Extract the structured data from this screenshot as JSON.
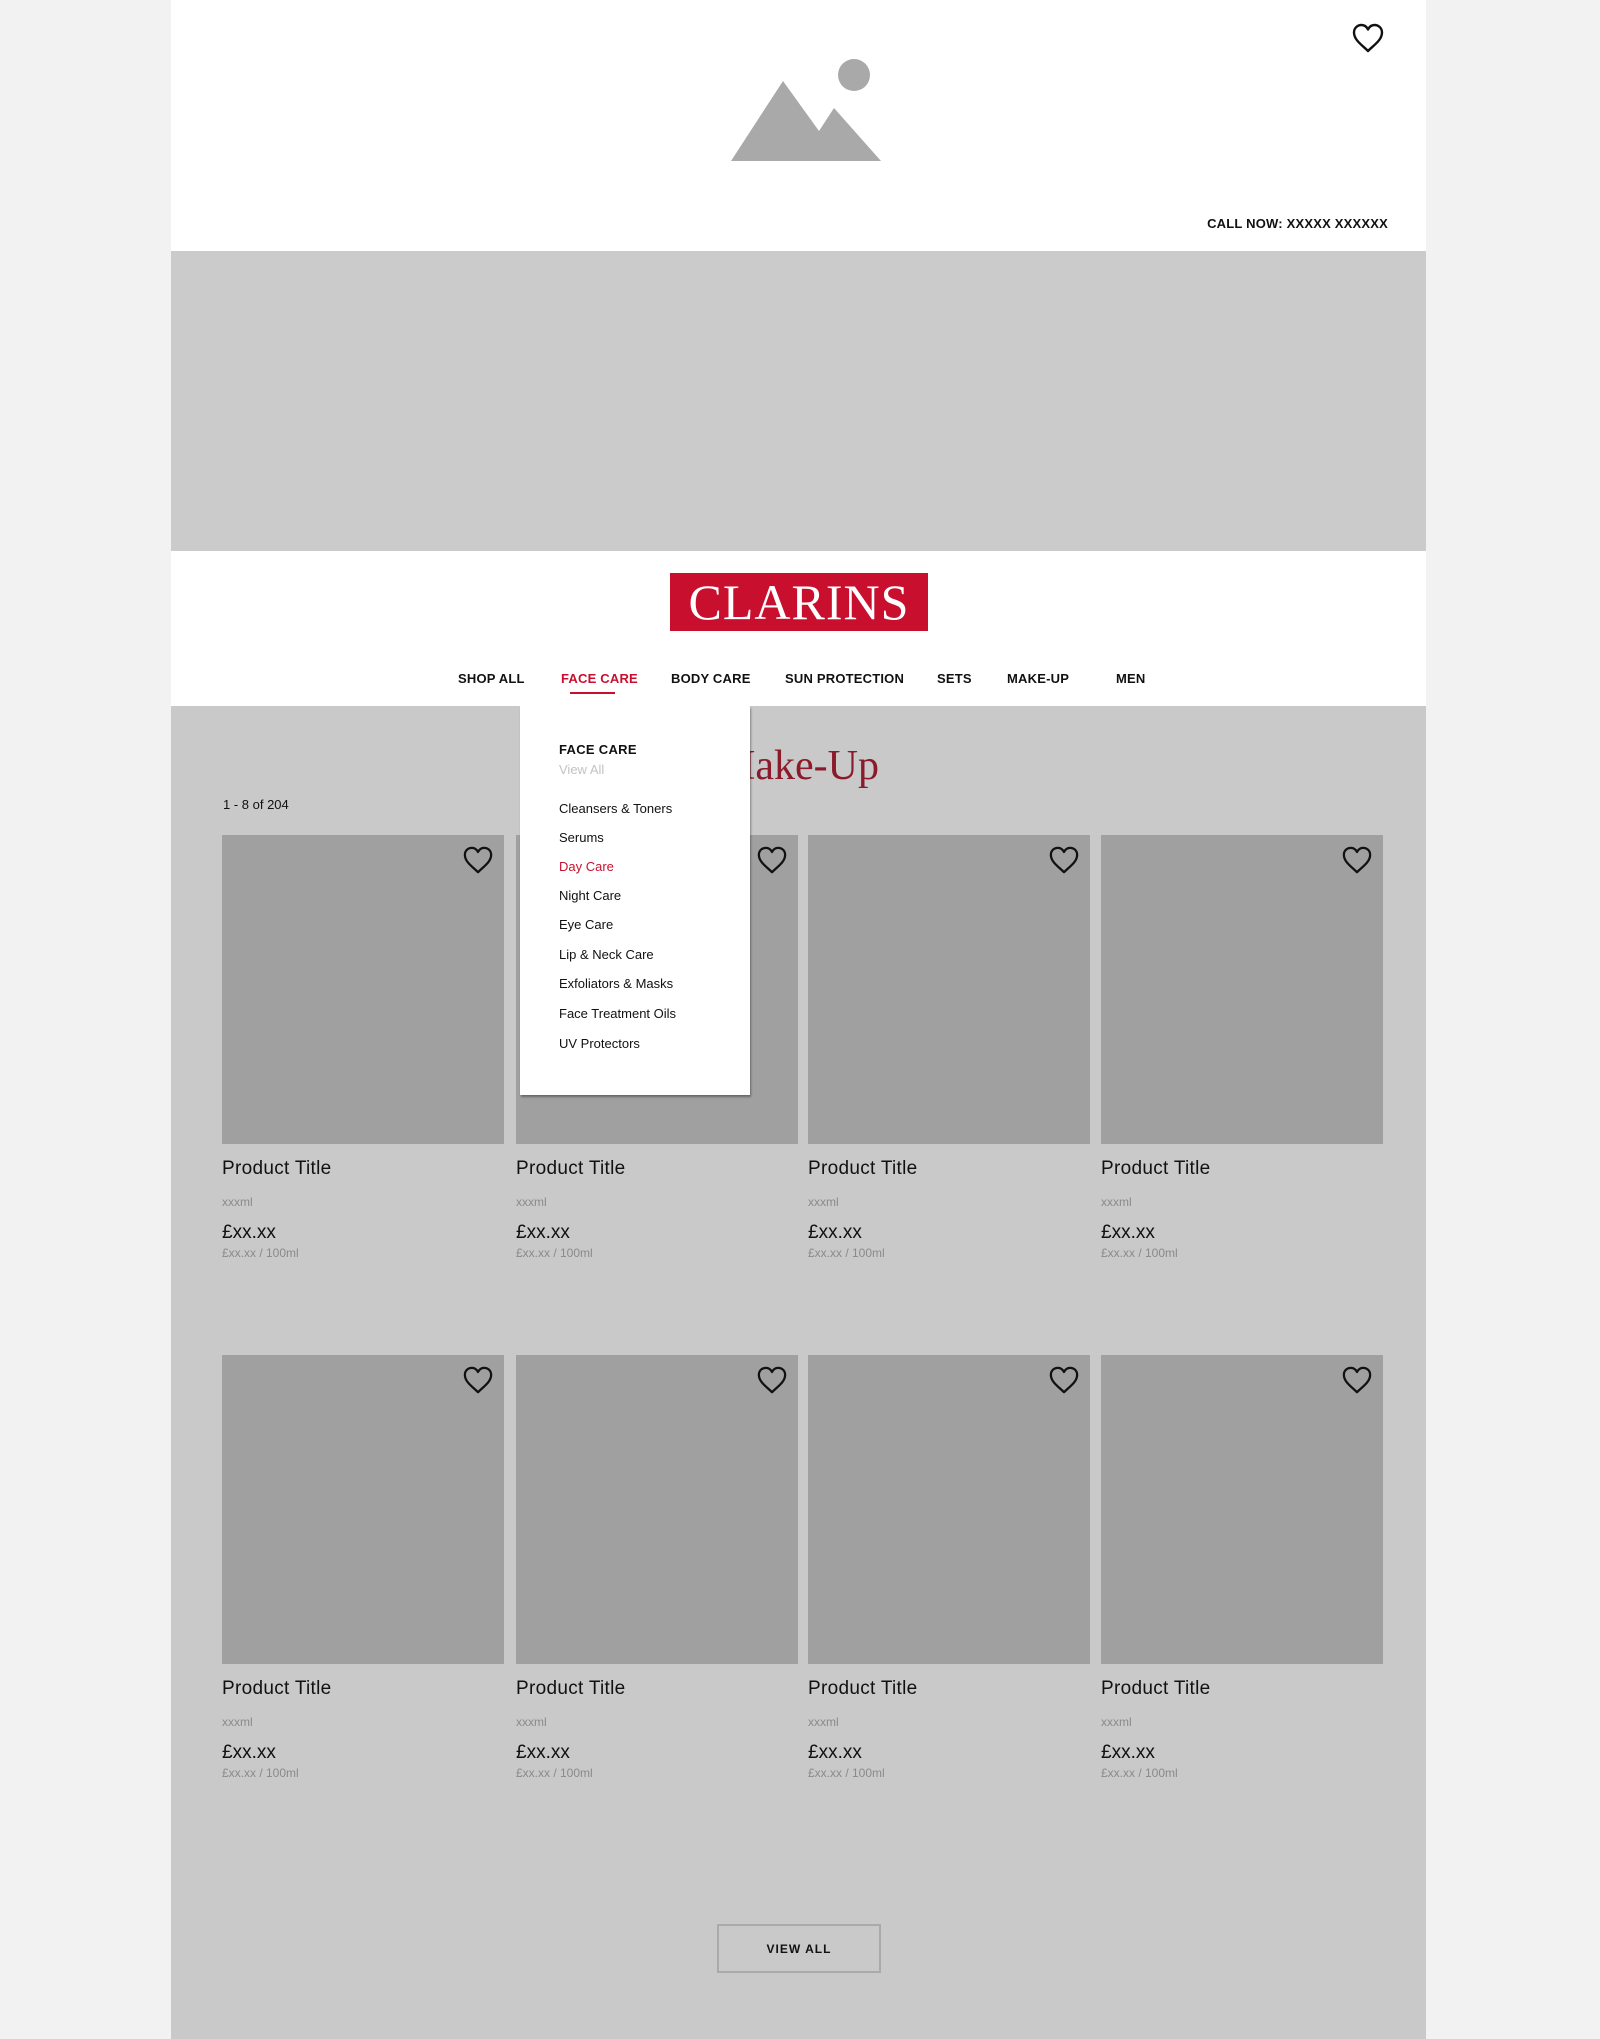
{
  "header": {
    "call_now": "CALL NOW: XXXXX XXXXXX",
    "wishlist_icon": "heart-outline-icon",
    "image_icon": "image-placeholder-icon"
  },
  "brand": {
    "logo_text": "CLARINS",
    "logo_color": "#c8102e"
  },
  "nav": {
    "items": [
      {
        "label": "SHOP ALL"
      },
      {
        "label": "FACE CARE",
        "active": true
      },
      {
        "label": "BODY CARE"
      },
      {
        "label": "SUN PROTECTION"
      },
      {
        "label": "SETS"
      },
      {
        "label": "MAKE-UP"
      },
      {
        "label": "MEN"
      }
    ]
  },
  "dropdown": {
    "title": "FACE CARE",
    "view_all": "View All",
    "items": [
      {
        "label": "Cleansers & Toners"
      },
      {
        "label": "Serums"
      },
      {
        "label": "Day Care",
        "active": true
      },
      {
        "label": "Night Care"
      },
      {
        "label": "Eye Care"
      },
      {
        "label": "Lip & Neck Care"
      },
      {
        "label": "Exfoliators & Masks"
      },
      {
        "label": "Face Treatment Oils"
      },
      {
        "label": "UV Protectors"
      }
    ]
  },
  "listing": {
    "heading": "Make-Up",
    "count": "1 - 8 of 204",
    "products": [
      {
        "title": "Product Title",
        "size": "xxxml",
        "price": "£xx.xx",
        "unit_price": "£xx.xx / 100ml"
      },
      {
        "title": "Product Title",
        "size": "xxxml",
        "price": "£xx.xx",
        "unit_price": "£xx.xx / 100ml"
      },
      {
        "title": "Product Title",
        "size": "xxxml",
        "price": "£xx.xx",
        "unit_price": "£xx.xx / 100ml"
      },
      {
        "title": "Product Title",
        "size": "xxxml",
        "price": "£xx.xx",
        "unit_price": "£xx.xx / 100ml"
      },
      {
        "title": "Product Title",
        "size": "xxxml",
        "price": "£xx.xx",
        "unit_price": "£xx.xx / 100ml"
      },
      {
        "title": "Product Title",
        "size": "xxxml",
        "price": "£xx.xx",
        "unit_price": "£xx.xx / 100ml"
      },
      {
        "title": "Product Title",
        "size": "xxxml",
        "price": "£xx.xx",
        "unit_price": "£xx.xx / 100ml"
      },
      {
        "title": "Product Title",
        "size": "xxxml",
        "price": "£xx.xx",
        "unit_price": "£xx.xx / 100ml"
      }
    ],
    "view_all_label": "VIEW ALL"
  },
  "colors": {
    "accent": "#c8102e",
    "heading": "#8b1a2b",
    "placeholder": "#a0a0a0",
    "background": "#c9c9c9"
  }
}
